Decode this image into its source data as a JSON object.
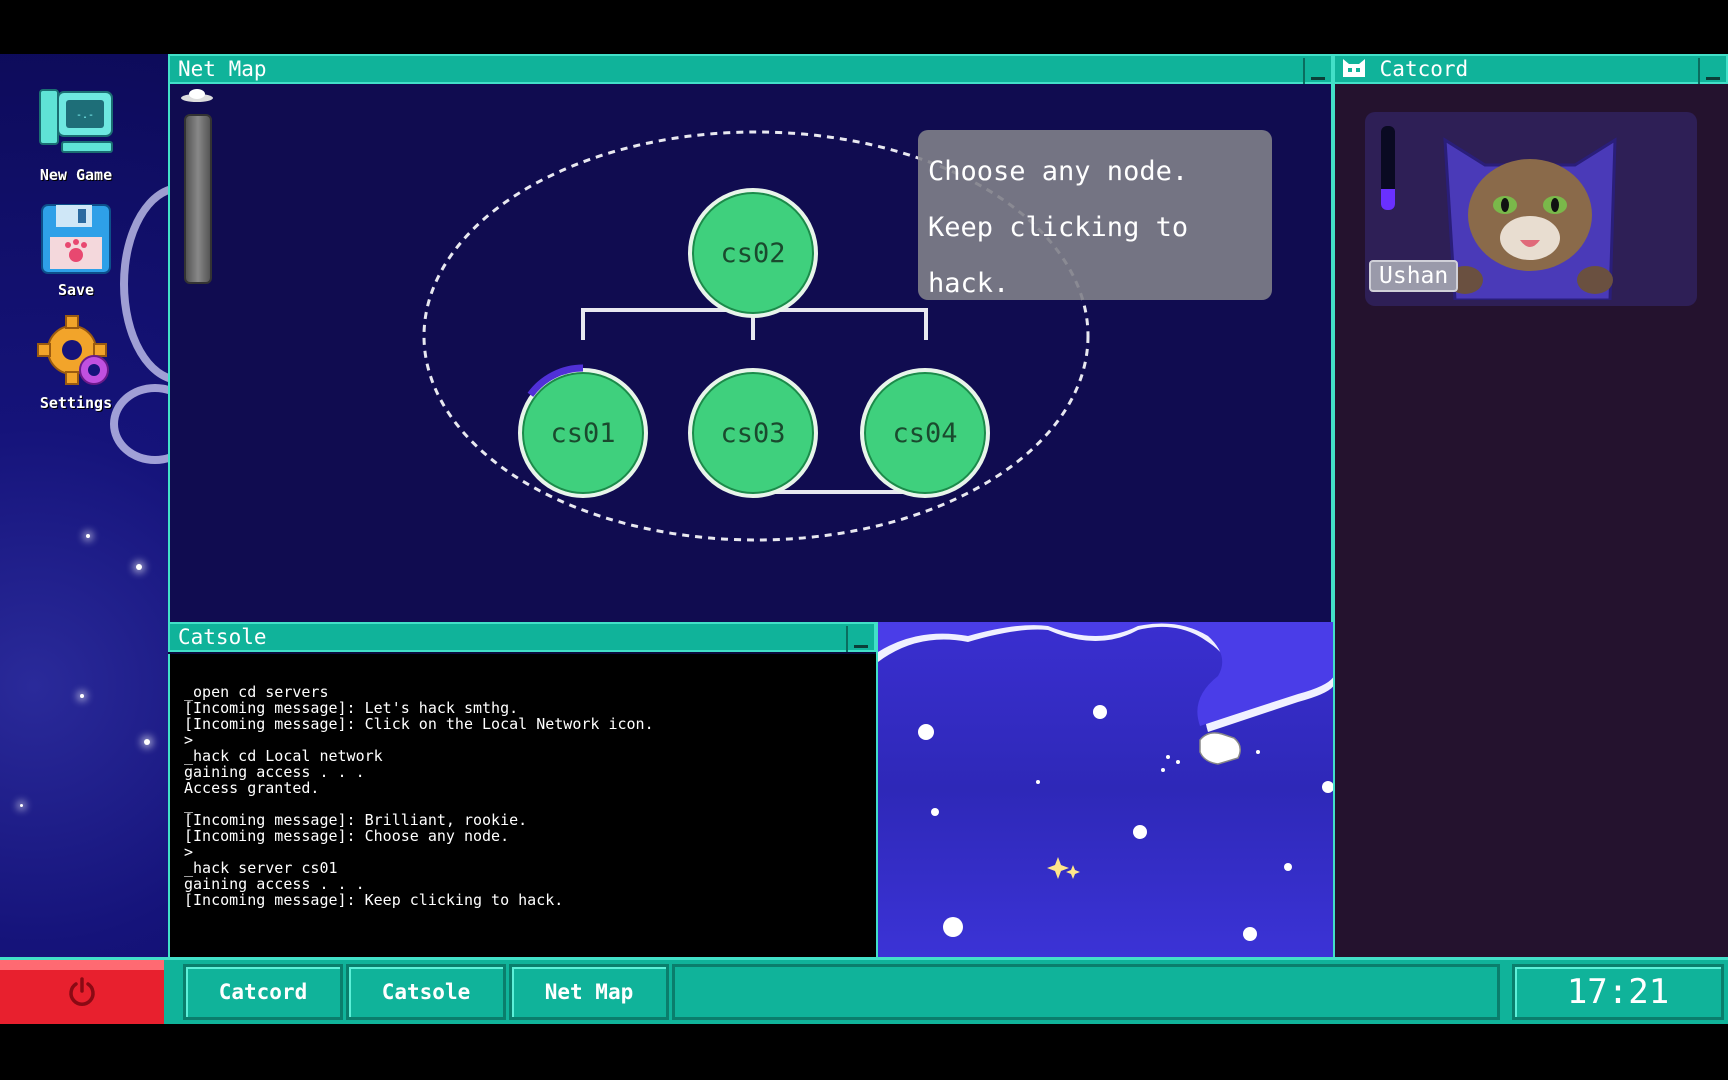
{
  "desktop": {
    "icons": [
      {
        "label": "New Game",
        "icon": "computer-icon"
      },
      {
        "label": "Save",
        "icon": "floppy-disk-icon"
      },
      {
        "label": "Settings",
        "icon": "gear-icon"
      }
    ]
  },
  "netmap": {
    "title": "Net Map",
    "nodes": [
      "cs02",
      "cs01",
      "cs03",
      "cs04"
    ],
    "hack_progress_cs01": 0.15,
    "tooltip": {
      "line1": "Choose any node.",
      "line2": "Keep clicking to hack."
    }
  },
  "catcord": {
    "title": "Catcord",
    "contact_name": "Ushan",
    "meter_level": 0.25
  },
  "catsole": {
    "title": "Catsole",
    "lines": [
      "_open cd servers",
      "[Incoming message]: Let's hack smthg.",
      "[Incoming message]: Click on the Local Network icon.",
      ">",
      "_hack cd Local network",
      "gaining access . . .",
      "Access granted.",
      "_",
      "[Incoming message]: Brilliant, rookie.",
      "[Incoming message]: Choose any node.",
      ">",
      "_hack server cs01",
      "gaining access . . .",
      "[Incoming message]: Keep clicking to hack."
    ]
  },
  "taskbar": {
    "buttons": [
      "Catcord",
      "Catsole",
      "Net Map"
    ],
    "clock": "17:21"
  },
  "colors": {
    "accent": "#10b39a",
    "node": "#3fd07d",
    "power": "#e8202e",
    "background": "#100c50"
  }
}
